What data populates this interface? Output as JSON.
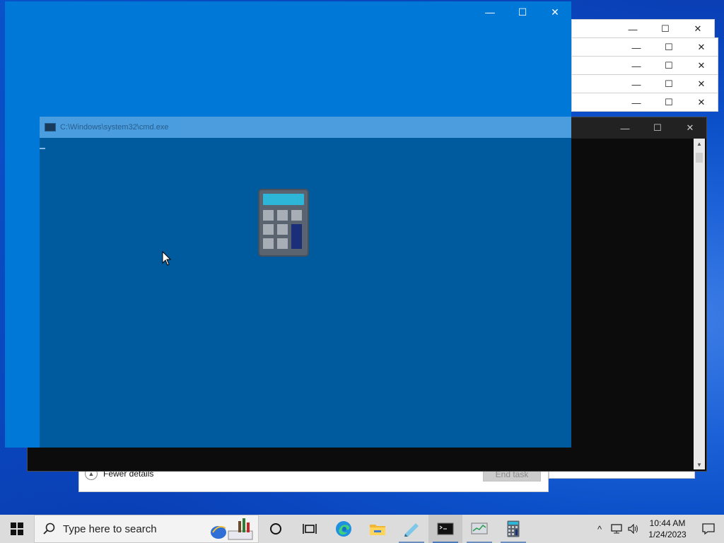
{
  "cmd_window": {
    "title": "C:\\Windows\\system32\\cmd.exe",
    "controls": {
      "minimize": "—",
      "maximize": "☐",
      "close": "✕"
    }
  },
  "calculator_window": {
    "controls": {
      "minimize": "—",
      "maximize": "☐",
      "close": "✕"
    }
  },
  "background_windows": {
    "controls": {
      "minimize": "—",
      "maximize": "☐",
      "close": "✕"
    }
  },
  "task_manager": {
    "fewer_details_label": "Fewer details",
    "end_task_label": "End task"
  },
  "taskbar": {
    "search_placeholder": "Type here to search",
    "clock_time": "10:44 AM",
    "clock_date": "1/24/2023",
    "pinned": [
      "cortana-icon",
      "task-view-icon",
      "edge-icon",
      "file-explorer-icon",
      "notepad-icon",
      "cmd-icon",
      "task-manager-icon",
      "calculator-icon"
    ]
  },
  "colors": {
    "calc_blue": "#0078d7",
    "calc_overlay": "#005a9e",
    "cmd_bg": "#0c0c0c",
    "taskbar_bg": "#dcdcdc"
  }
}
